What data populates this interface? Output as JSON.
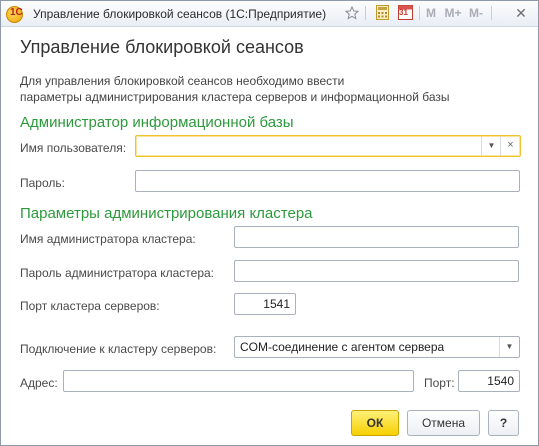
{
  "window": {
    "title": "Управление блокировкой сеансов (1С:Предприятие)",
    "app_icon_glyph": "1С",
    "toolbar": {
      "favorite_icon": "star-icon",
      "calculator_icon": "calculator-icon",
      "calendar_icon": "calendar-icon",
      "calendar_day": "31",
      "m_label": "M",
      "m_plus_label": "M+",
      "m_minus_label": "M-",
      "close_label": "✕"
    }
  },
  "form": {
    "title": "Управление блокировкой сеансов",
    "description_line1": "Для управления блокировкой сеансов необходимо ввести",
    "description_line2": "параметры администрирования кластера серверов и информационной базы",
    "section_ib_admin": "Администратор информационной базы",
    "user_name_label": "Имя пользователя:",
    "user_name_value": "",
    "password_label": "Пароль:",
    "password_value": "",
    "section_cluster_admin": "Параметры администрирования кластера",
    "cluster_admin_name_label": "Имя администратора кластера:",
    "cluster_admin_name_value": "",
    "cluster_admin_password_label": "Пароль администратора кластера:",
    "cluster_admin_password_value": "",
    "cluster_port_label": "Порт кластера серверов:",
    "cluster_port_value": "1541",
    "connection_label": "Подключение к кластеру серверов:",
    "connection_value": "COM-соединение с агентом сервера",
    "address_label": "Адрес:",
    "address_value": "",
    "port_label": "Порт:",
    "port_value": "1540"
  },
  "buttons": {
    "ok": "ОК",
    "cancel": "Отмена",
    "help": "?"
  },
  "colors": {
    "section_heading": "#2c9a3c",
    "primary_button": "#f6d000",
    "focus_border": "#f0c330"
  }
}
